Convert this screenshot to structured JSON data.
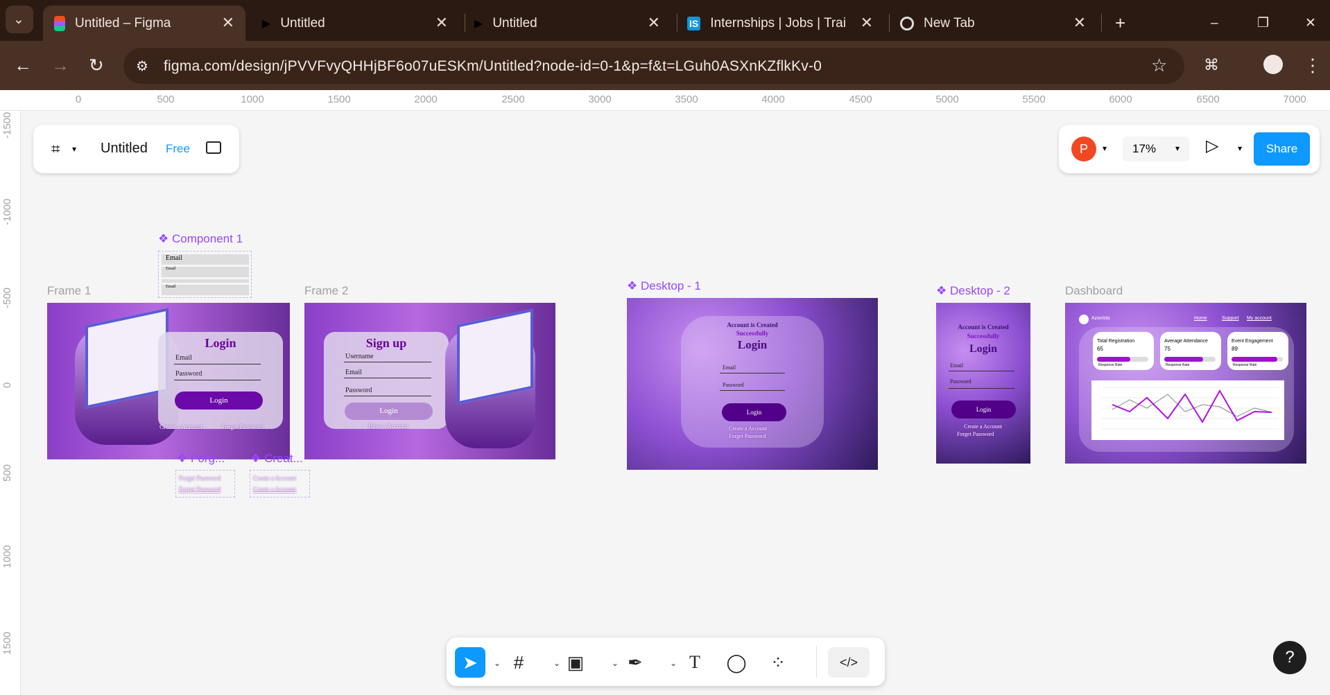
{
  "browser": {
    "tabs": [
      {
        "title": "Untitled – Figma",
        "icon": "figma-icon",
        "active": true
      },
      {
        "title": "Untitled",
        "icon": "play-icon"
      },
      {
        "title": "Untitled",
        "icon": "play-icon"
      },
      {
        "title": "Internships | Jobs | Trainir",
        "icon": "is-icon",
        "badge": "IS"
      },
      {
        "title": "New Tab",
        "icon": "chrome-icon"
      }
    ],
    "url": "figma.com/design/jPVVFvyQHHjBF6o07uESKm/Untitled?node-id=0-1&p=f&t=LGuh0ASXnKZflkKv-0",
    "window_controls": [
      "–",
      "❐",
      "✕"
    ]
  },
  "ruler": {
    "top": [
      "0",
      "500",
      "1000",
      "1500",
      "2000",
      "2500",
      "3000",
      "3500",
      "4000",
      "4500",
      "5000",
      "5500",
      "6000",
      "6500",
      "7000"
    ],
    "left": [
      "-1500",
      "-1000",
      "-500",
      "0",
      "500",
      "1000",
      "1500"
    ]
  },
  "figma": {
    "file_name": "Untitled",
    "plan": "Free",
    "avatar_initial": "P",
    "zoom": "17%",
    "share_label": "Share",
    "help": "?"
  },
  "canvas": {
    "component1": {
      "label": "❖ Component 1",
      "rows": [
        "Email",
        "Email",
        "",
        "Email"
      ]
    },
    "frame1": {
      "label": "Frame 1",
      "title": "Login",
      "fields": [
        "Email",
        "Password"
      ],
      "button": "Login",
      "links": [
        "Create a Account",
        "Forget Password"
      ]
    },
    "frame2": {
      "label": "Frame 2",
      "title": "Sign up",
      "fields": [
        "Username",
        "Email",
        "Password"
      ],
      "button": "Login",
      "link": "Have a Account"
    },
    "forg": {
      "label": "❖ Forg...",
      "texts": [
        "Forget Password",
        "Forget Password"
      ]
    },
    "creat": {
      "label": "❖ Creat...",
      "texts": [
        "Create a Account",
        "Create a Account"
      ]
    },
    "desktop1": {
      "label": "❖ Desktop - 1",
      "heading1": "Account is Created",
      "heading2": "Successfully",
      "title": "Login",
      "fields": [
        "Email",
        "Password"
      ],
      "button": "Login",
      "links": [
        "Create a Account",
        "Forget Password"
      ]
    },
    "desktop2": {
      "label": "❖ Desktop - 2",
      "heading1": "Account is Created",
      "heading2": "Successfully",
      "title": "Login",
      "fields": [
        "Email",
        "Password"
      ],
      "button": "Login",
      "links": [
        "Create a Account",
        "Forget Password"
      ]
    },
    "dashboard": {
      "label": "Dashboard",
      "brand": "Azavista",
      "nav": [
        "Home",
        "Support",
        "My account"
      ],
      "cards": [
        {
          "title": "Total Registration",
          "value": "65",
          "sub": "Response Rate"
        },
        {
          "title": "Average Attendance",
          "value": "75",
          "sub": "Response Rate"
        },
        {
          "title": "Event Engagement",
          "value": "89",
          "sub": "Response Rate"
        }
      ]
    }
  }
}
